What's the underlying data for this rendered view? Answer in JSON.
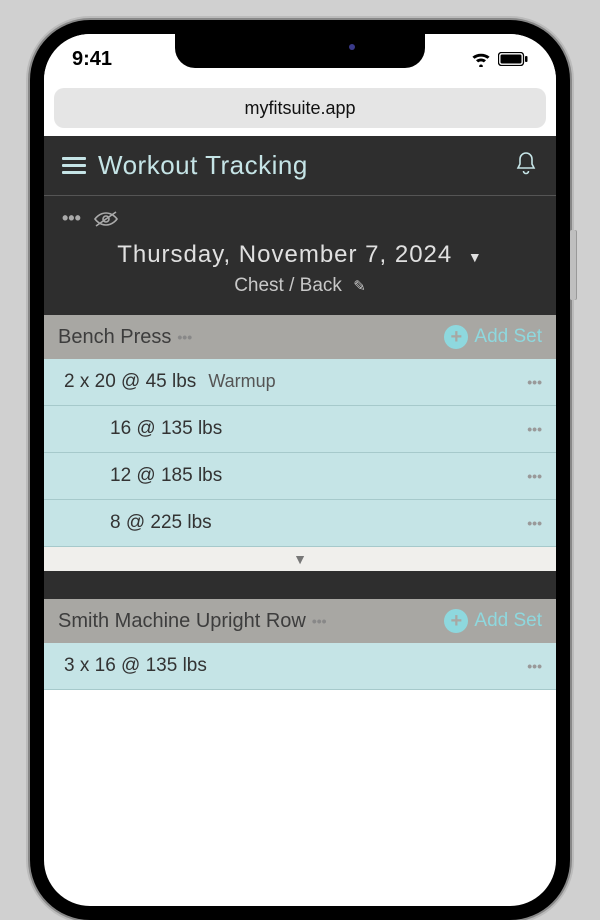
{
  "status": {
    "time": "9:41"
  },
  "browser": {
    "url": "myfitsuite.app"
  },
  "header": {
    "title": "Workout Tracking"
  },
  "date_section": {
    "date": "Thursday, November 7, 2024",
    "workout_name": "Chest / Back"
  },
  "exercises": [
    {
      "name": "Bench Press",
      "add_label": "Add Set",
      "sets": [
        {
          "text": "2 x 20 @ 45 lbs",
          "label": "Warmup",
          "indent": false
        },
        {
          "text": "16 @ 135 lbs",
          "label": "",
          "indent": true
        },
        {
          "text": "12 @ 185 lbs",
          "label": "",
          "indent": true
        },
        {
          "text": "8 @ 225 lbs",
          "label": "",
          "indent": true
        }
      ]
    },
    {
      "name": "Smith Machine Upright Row",
      "add_label": "Add Set",
      "sets": [
        {
          "text": "3 x 16 @ 135 lbs",
          "label": "",
          "indent": false
        }
      ]
    }
  ]
}
